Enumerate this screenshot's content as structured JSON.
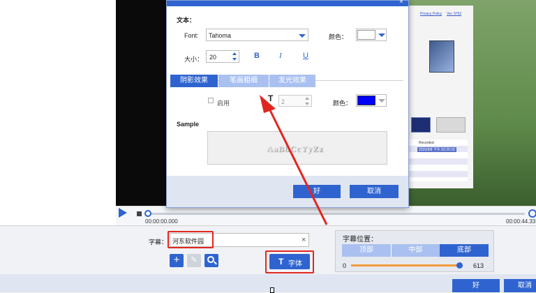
{
  "background": {
    "links": [
      "Privacy Policy",
      "Ver. 9762"
    ],
    "recorded_header": "Recorded",
    "recorded_date": "2020/9/8 下午 02:20:19"
  },
  "player": {
    "time_start": "00:00:00.000",
    "time_end": "00:00:44.33",
    "progress": 0
  },
  "dialog": {
    "section_text": "文本：",
    "font_label": "Font:",
    "font_value": "Tahoma",
    "color_label": "颜色：",
    "font_color": "#ffffff",
    "size_label": "大小：",
    "size_value": "20",
    "bold": "B",
    "italic": "I",
    "underline": "U",
    "tabs": [
      "阴影效果",
      "笔画粗细",
      "发光效果"
    ],
    "active_tab": 0,
    "enable_label": "启用",
    "offset_icon": "T",
    "offset_value": "2",
    "shadow_color_label": "颜色：",
    "shadow_color": "#0000ff",
    "sample_label": "Sample",
    "sample_text": "AaBbCcYyZz",
    "ok": "好",
    "cancel": "取消"
  },
  "subtitle": {
    "label": "字幕：",
    "value": "河东软件园",
    "clear_icon": "×",
    "font_button_icon": "T",
    "font_button_label": "字体"
  },
  "position": {
    "title": "字幕位置：",
    "segments": [
      "顶部",
      "中部",
      "底部"
    ],
    "selected": "底部",
    "min": "0",
    "max": "613"
  },
  "footer": {
    "ok": "好",
    "cancel": "取消"
  },
  "colors": {
    "accent": "#2f64d0",
    "highlight": "#e0271f"
  }
}
